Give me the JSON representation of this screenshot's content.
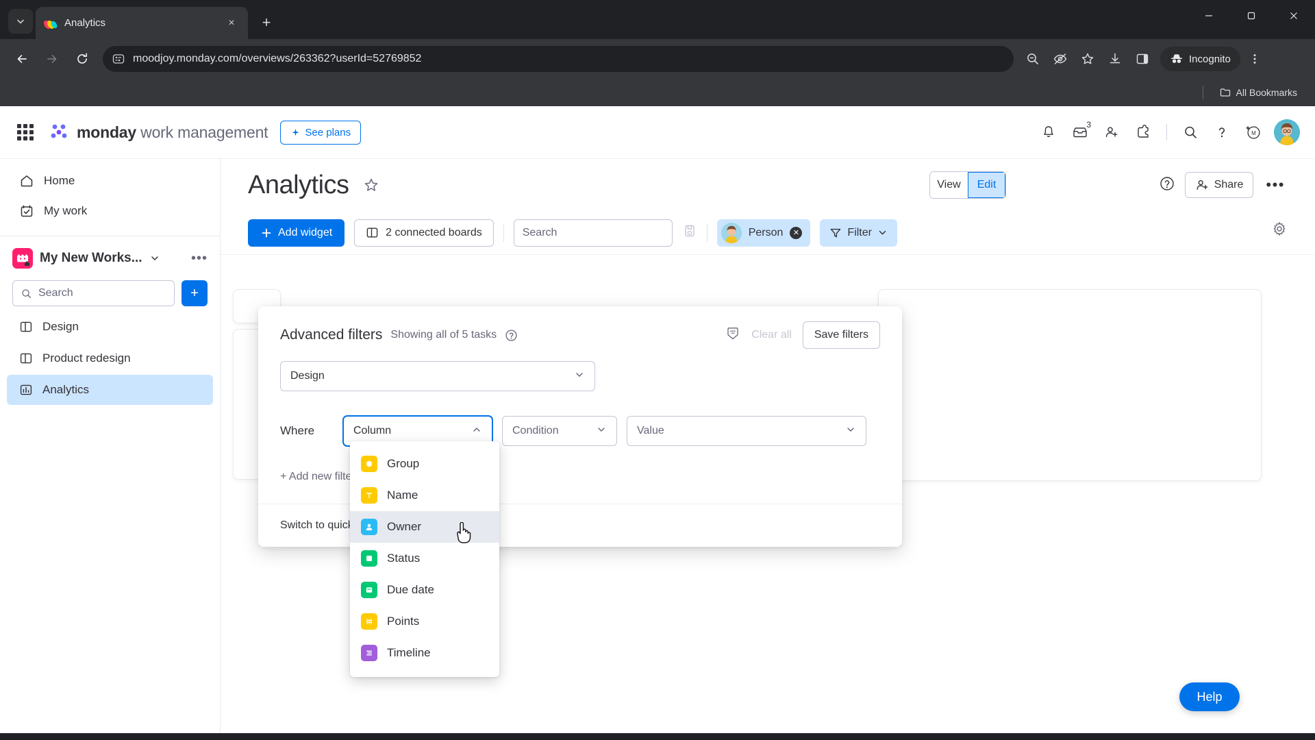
{
  "browser": {
    "tab": {
      "title": "Analytics",
      "favicon": "monday-favicon",
      "close_label": "×"
    },
    "tab_list_icon": "chevron-down-icon",
    "new_tab_label": "+",
    "window_controls": {
      "minimize": "—",
      "maximize": "❐",
      "close": "✕"
    },
    "nav": {
      "back": "←",
      "forward": "→",
      "reload": "⟳"
    },
    "omnibox": {
      "site_info_icon": "page-info-icon",
      "url": "moodjoy.monday.com/overviews/263362?userId=52769852"
    },
    "toolbar_icons": [
      "zoom-out-icon",
      "eye-off-icon",
      "bookmark-star-icon",
      "download-icon",
      "side-panel-icon"
    ],
    "incognito": {
      "label": "Incognito",
      "icon": "incognito-icon"
    },
    "menu_icon": "kebab-menu-icon",
    "bookmarks": {
      "all_label": "All Bookmarks",
      "folder_icon": "folder-icon"
    }
  },
  "header": {
    "apps_icon": "waffle-grid-icon",
    "brand_bold": "monday",
    "brand_rest": " work management",
    "see_plans": "See plans",
    "icons": [
      {
        "name": "notifications-bell-icon",
        "badge": ""
      },
      {
        "name": "inbox-icon",
        "badge": "3"
      },
      {
        "name": "invite-member-icon",
        "badge": ""
      },
      {
        "name": "apps-marketplace-icon",
        "badge": ""
      },
      {
        "name": "search-icon",
        "badge": ""
      },
      {
        "name": "help-question-icon",
        "badge": ""
      },
      {
        "name": "ai-sparkle-icon",
        "badge": ""
      }
    ],
    "avatar": "user-avatar"
  },
  "sidebar": {
    "top_items": [
      {
        "label": "Home",
        "icon": "home-icon"
      },
      {
        "label": "My work",
        "icon": "my-work-calendar-icon"
      }
    ],
    "workspace": {
      "name": "My New Works...",
      "caret": "chevron-down-icon",
      "more": "•••"
    },
    "search": {
      "placeholder": "Search",
      "value": "",
      "icon": "search-icon"
    },
    "add_button": "+",
    "boards": [
      {
        "label": "Design",
        "icon": "board-icon",
        "active": false
      },
      {
        "label": "Product redesign",
        "icon": "board-icon",
        "active": false
      },
      {
        "label": "Analytics",
        "icon": "dashboard-chart-icon",
        "active": true
      }
    ]
  },
  "main": {
    "title": "Analytics",
    "star_icon": "favorite-star-icon",
    "view_edit": {
      "view": "View",
      "edit": "Edit",
      "selected": "Edit"
    },
    "help_icon": "help-circle-icon",
    "share": {
      "label": "Share",
      "icon": "person-add-icon"
    },
    "more": "•••",
    "toolbar": {
      "add_widget": "Add widget",
      "connected_boards": "2 connected boards",
      "search_placeholder": "Search",
      "search_value": "",
      "save_view_icon": "save-view-icon",
      "person_chip": "Person",
      "filter_label": "Filter"
    },
    "settings_icon": "gear-icon"
  },
  "filters_modal": {
    "title": "Advanced filters",
    "subtitle": "Showing all of 5 tasks",
    "info_icon": "help-circle-icon",
    "history_icon": "filter-history-icon",
    "clear_all": "Clear all",
    "save_filters": "Save filters",
    "board": {
      "value": "Design",
      "caret": "chevron-down-icon"
    },
    "where_label": "Where",
    "column": {
      "placeholder": "Column",
      "caret": "chevron-up-icon"
    },
    "condition": {
      "placeholder": "Condition",
      "caret": "chevron-down-icon"
    },
    "value": {
      "placeholder": "Value",
      "caret": "chevron-down-icon"
    },
    "add_new_filter": "+ Add new filter",
    "switch_to_quick": "Switch to quick filters"
  },
  "column_dropdown": {
    "items": [
      {
        "label": "Group",
        "icon": "group-circle-icon",
        "color": "#ffcb00",
        "hover": false
      },
      {
        "label": "Name",
        "icon": "text-name-icon",
        "color": "#fdcb00",
        "hover": false
      },
      {
        "label": "Owner",
        "icon": "person-owner-icon",
        "color": "#2bbbf4",
        "hover": true
      },
      {
        "label": "Status",
        "icon": "status-icon",
        "color": "#00c875",
        "hover": false
      },
      {
        "label": "Due date",
        "icon": "date-icon",
        "color": "#00c875",
        "hover": false
      },
      {
        "label": "Points",
        "icon": "numbers-icon",
        "color": "#ffcb00",
        "hover": false
      },
      {
        "label": "Timeline",
        "icon": "timeline-icon",
        "color": "#a25ddc",
        "hover": false
      }
    ]
  },
  "help_fab": {
    "label": "Help"
  },
  "colors": {
    "accent_blue": "#0073ea",
    "chip_blue": "#cce5ff",
    "text_dark": "#323338",
    "text_muted": "#676879",
    "border": "#c3c6d4"
  }
}
